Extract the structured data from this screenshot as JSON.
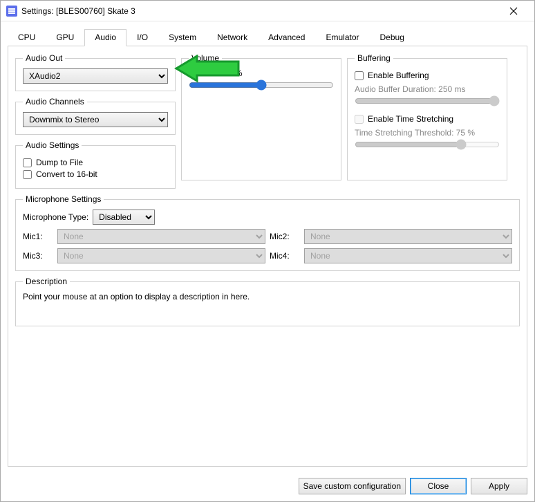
{
  "window": {
    "title": "Settings: [BLES00760] Skate 3"
  },
  "tabs": [
    "CPU",
    "GPU",
    "Audio",
    "I/O",
    "System",
    "Network",
    "Advanced",
    "Emulator",
    "Debug"
  ],
  "activeTab": "Audio",
  "audioOut": {
    "legend": "Audio Out",
    "value": "XAudio2"
  },
  "audioChannels": {
    "legend": "Audio Channels",
    "value": "Downmix to Stereo"
  },
  "audioSettings": {
    "legend": "Audio Settings",
    "dumpToFile": {
      "label": "Dump to File",
      "checked": false
    },
    "convert16": {
      "label": "Convert to 16-bit",
      "checked": false
    }
  },
  "volume": {
    "legend": "Volume",
    "masterLabel": "Master: 100 %",
    "sliderValue": 100,
    "sliderMin": 0,
    "sliderMax": 200
  },
  "buffering": {
    "legend": "Buffering",
    "enableBuffering": {
      "label": "Enable Buffering",
      "checked": false
    },
    "durationLabel": "Audio Buffer Duration: 250 ms",
    "durationValue": 250,
    "durationMin": 0,
    "durationMax": 250,
    "enableStretch": {
      "label": "Enable Time Stretching",
      "checked": false
    },
    "stretchLabel": "Time Stretching Threshold: 75 %",
    "stretchValue": 75,
    "stretchMin": 0,
    "stretchMax": 100
  },
  "mic": {
    "legend": "Microphone Settings",
    "typeLabel": "Microphone Type:",
    "typeValue": "Disabled",
    "mic1Label": "Mic1:",
    "mic1Value": "None",
    "mic2Label": "Mic2:",
    "mic2Value": "None",
    "mic3Label": "Mic3:",
    "mic3Value": "None",
    "mic4Label": "Mic4:",
    "mic4Value": "None"
  },
  "description": {
    "legend": "Description",
    "text": "Point your mouse at an option to display a description in here."
  },
  "buttons": {
    "save": "Save custom configuration",
    "close": "Close",
    "apply": "Apply"
  }
}
